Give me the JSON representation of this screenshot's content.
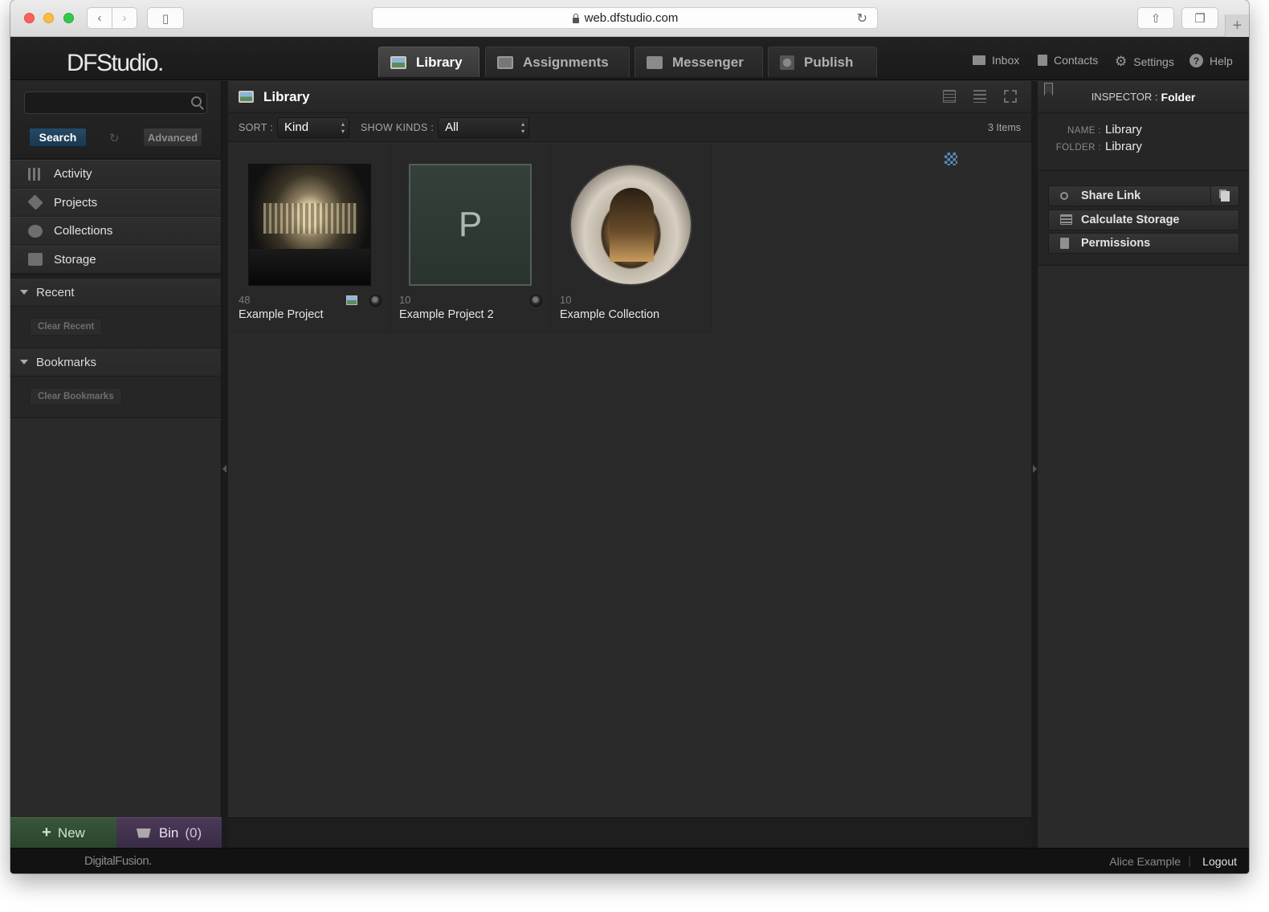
{
  "browser": {
    "url": "web.dfstudio.com"
  },
  "app": {
    "logo": "DFStudio.",
    "tabs": [
      {
        "label": "Library",
        "active": true
      },
      {
        "label": "Assignments",
        "active": false
      },
      {
        "label": "Messenger",
        "active": false
      },
      {
        "label": "Publish",
        "active": false
      }
    ],
    "utilities": {
      "inbox": "Inbox",
      "contacts": "Contacts",
      "settings": "Settings",
      "help": "Help"
    }
  },
  "sidebar": {
    "search": {
      "button": "Search",
      "advanced": "Advanced",
      "value": ""
    },
    "nav": [
      {
        "label": "Activity"
      },
      {
        "label": "Projects"
      },
      {
        "label": "Collections"
      },
      {
        "label": "Storage"
      }
    ],
    "recent": {
      "title": "Recent",
      "clear": "Clear Recent"
    },
    "bookmarks": {
      "title": "Bookmarks",
      "clear": "Clear Bookmarks"
    },
    "new_button": "New",
    "bin": {
      "label": "Bin",
      "count": "(0)"
    }
  },
  "main": {
    "title": "Library",
    "sort_label": "SORT :",
    "sort_value": "Kind",
    "kinds_label": "SHOW KINDS :",
    "kinds_value": "All",
    "count": "3 Items",
    "items": [
      {
        "count": "48",
        "name": "Example Project",
        "icon": "night-monument-photo"
      },
      {
        "count": "10",
        "name": "Example Project 2",
        "letter": "P"
      },
      {
        "count": "10",
        "name": "Example Collection",
        "icon": "archway-photo"
      }
    ]
  },
  "inspector": {
    "label": "INSPECTOR :",
    "kind": "Folder",
    "props": [
      {
        "key": "NAME :",
        "value": "Library"
      },
      {
        "key": "FOLDER :",
        "value": "Library"
      }
    ],
    "actions": {
      "share": "Share Link",
      "storage": "Calculate Storage",
      "permissions": "Permissions"
    }
  },
  "footer": {
    "brand": "DigitalFusion.",
    "user": "Alice Example",
    "separator": "|",
    "logout": "Logout"
  },
  "colors": {
    "accent_search": "#264a66",
    "new_button": "#38553a",
    "bin_button": "#4a3958"
  }
}
